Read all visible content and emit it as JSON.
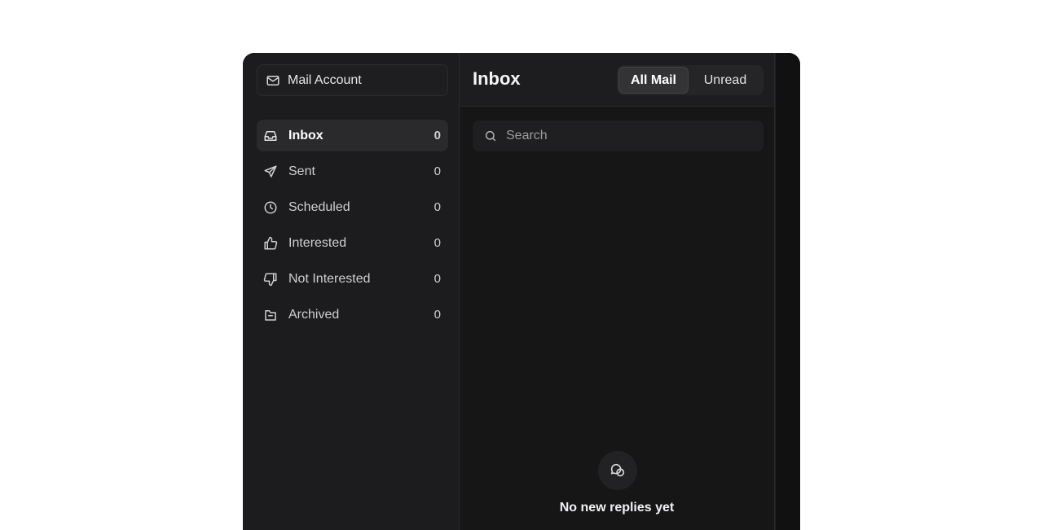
{
  "account": {
    "label": "Mail Account",
    "icon": "mail-icon"
  },
  "nav": [
    {
      "label": "Inbox",
      "count": "0",
      "icon": "inbox-icon",
      "active": true
    },
    {
      "label": "Sent",
      "count": "0",
      "icon": "send-icon",
      "active": false
    },
    {
      "label": "Scheduled",
      "count": "0",
      "icon": "clock-icon",
      "active": false
    },
    {
      "label": "Interested",
      "count": "0",
      "icon": "thumbs-up-icon",
      "active": false
    },
    {
      "label": "Not Interested",
      "count": "0",
      "icon": "thumbs-down-icon",
      "active": false
    },
    {
      "label": "Archived",
      "count": "0",
      "icon": "archive-icon",
      "active": false
    }
  ],
  "header": {
    "title": "Inbox",
    "filter_all": "All Mail",
    "filter_unread": "Unread",
    "selected": "All Mail"
  },
  "search": {
    "placeholder": "Search",
    "value": ""
  },
  "empty": {
    "icon": "chat-bubbles-icon",
    "title": "No new replies yet",
    "subtitle": ""
  },
  "colors": {
    "window_bg": "#151516",
    "sidebar_bg": "#1c1c1e",
    "active_item_bg": "#2a2a2d"
  }
}
